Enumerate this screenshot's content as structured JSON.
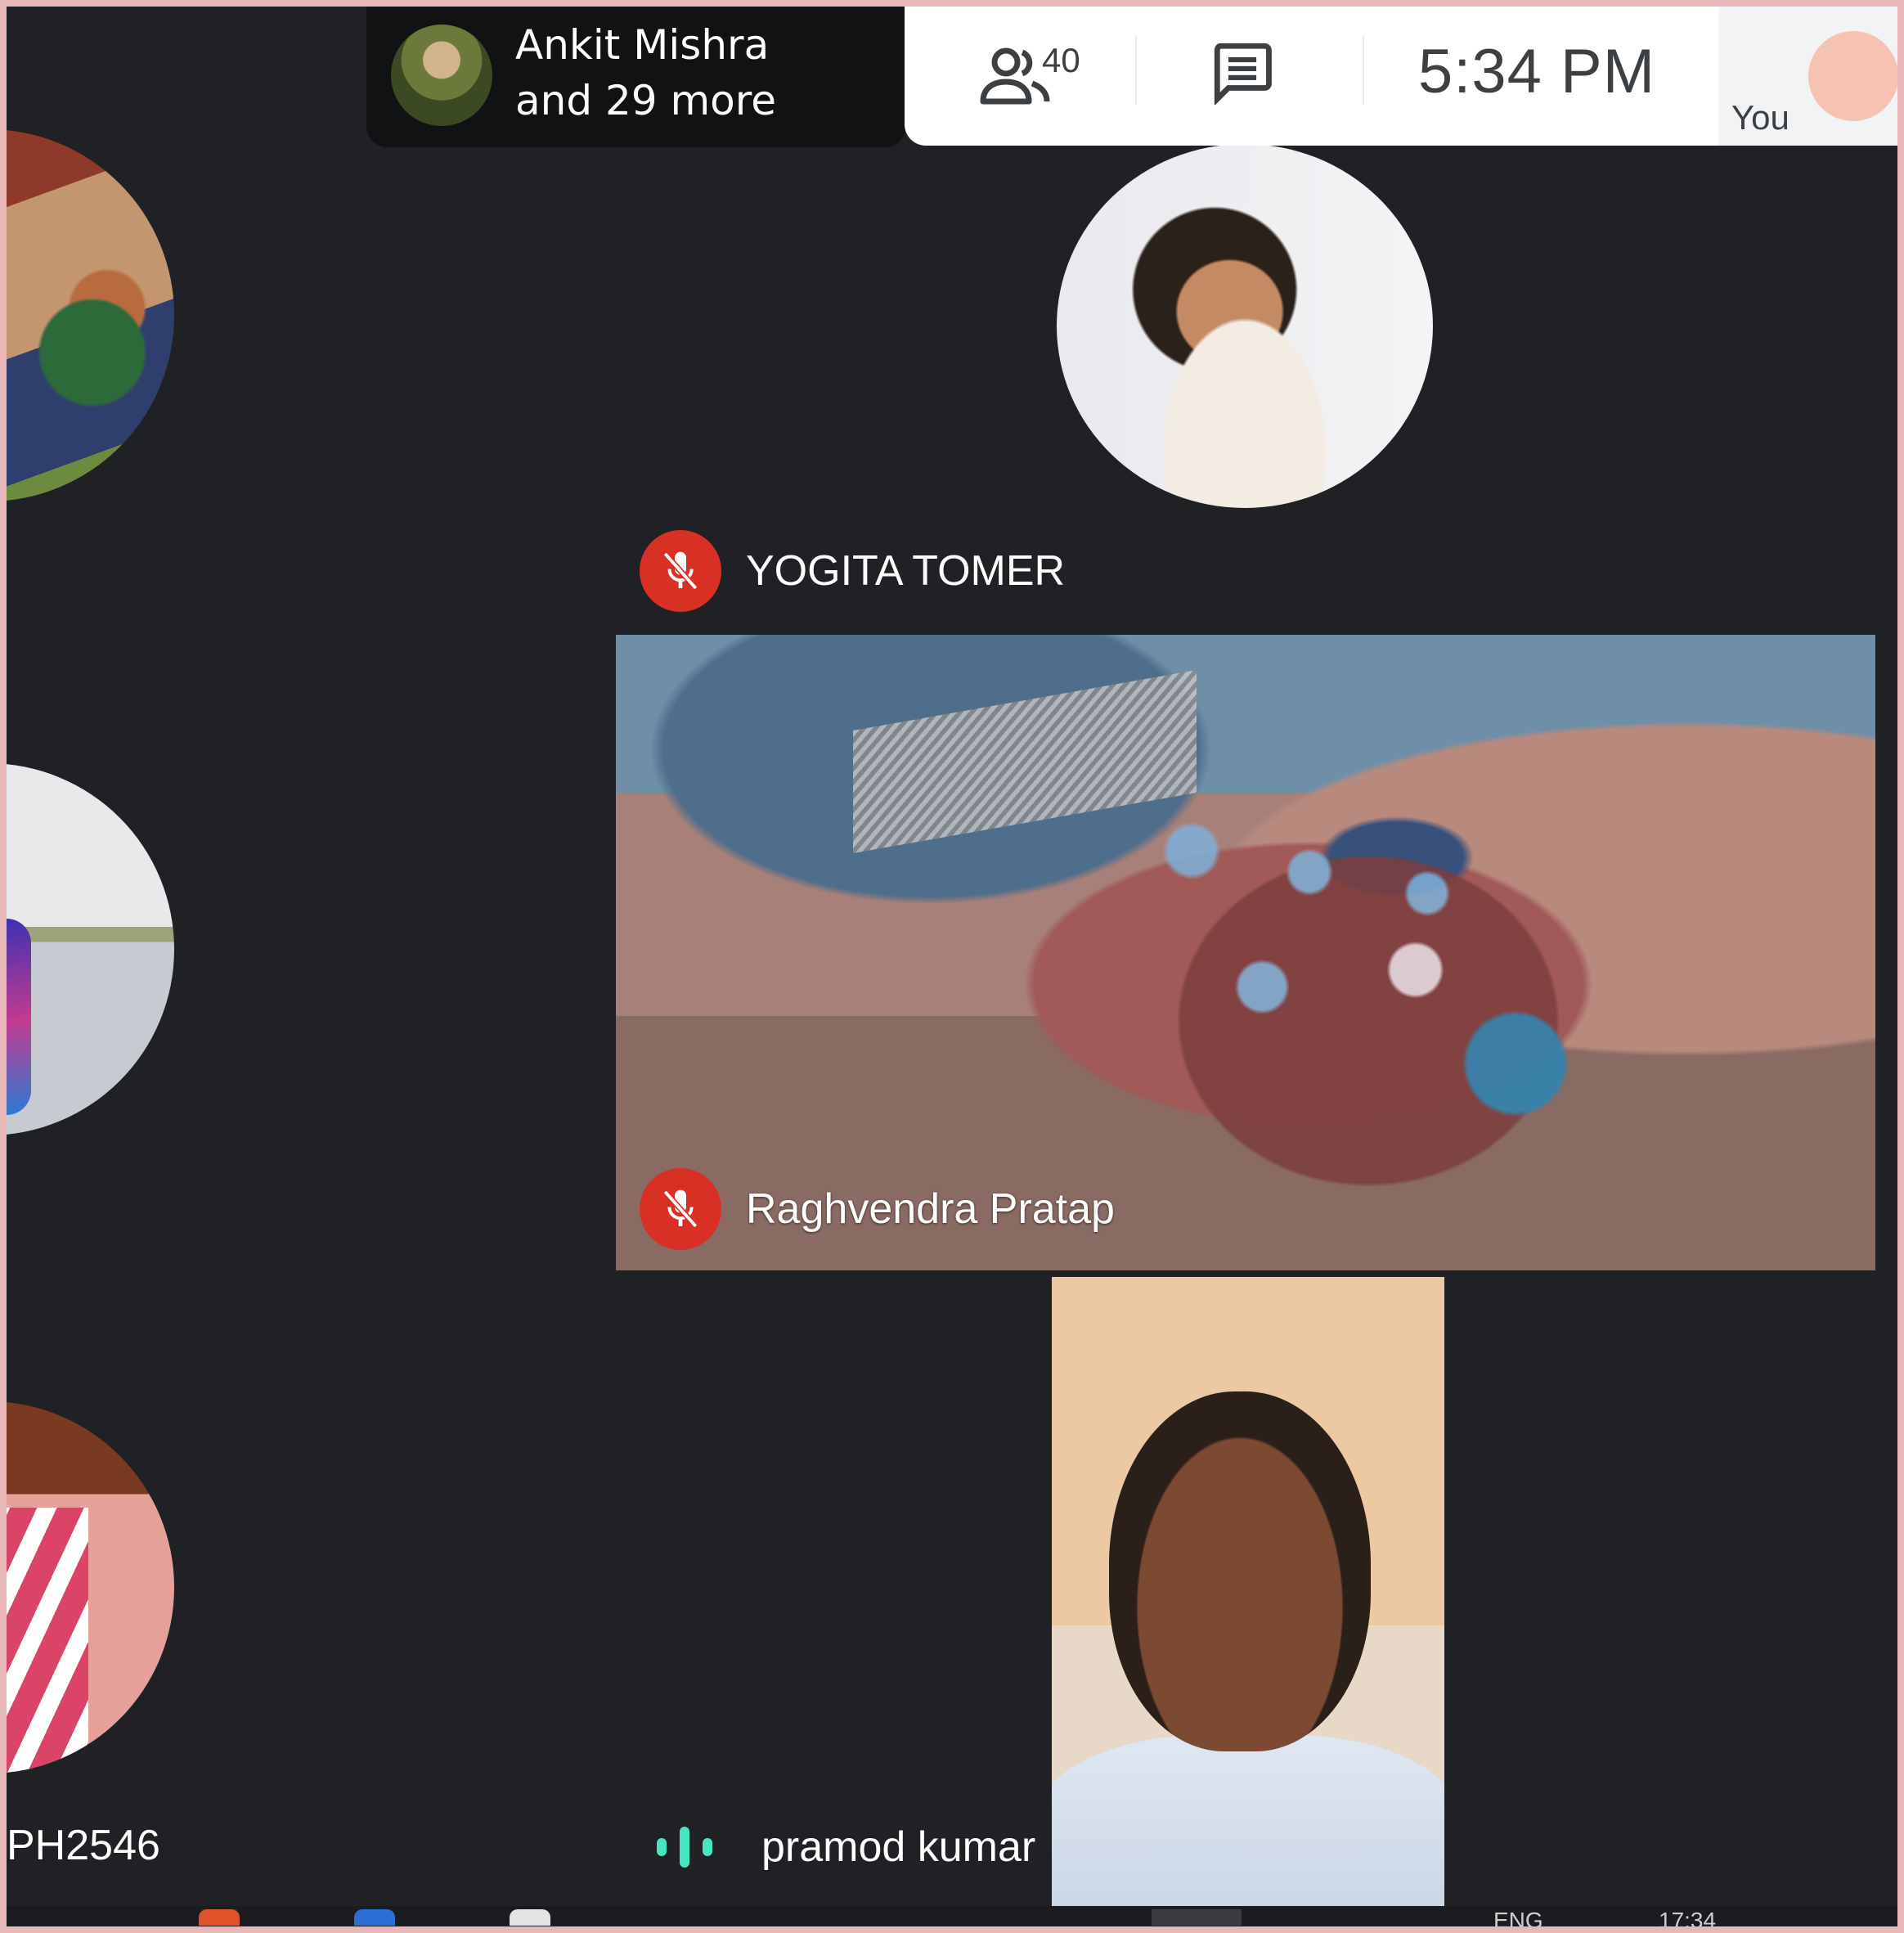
{
  "presenter": {
    "line1": "Ankit Mishra",
    "line2": "and 29 more"
  },
  "topbar": {
    "people_count": "40",
    "time": "5:34  PM",
    "self_label": "You"
  },
  "side": {
    "bottom_name": "PH2546"
  },
  "tiles": {
    "yogita": {
      "name": "YOGITA TOMER"
    },
    "raghvendra": {
      "name": "Raghvendra Pratap"
    },
    "pramod": {
      "name": "pramod kumar"
    }
  },
  "taskbar": {
    "lang": "ENG",
    "clock": "17:34"
  },
  "colors": {
    "mic_off": "#d93025",
    "speaking": "#46e6c2",
    "background": "#202124",
    "frame": "#e8b7b7"
  },
  "icons": [
    "people-icon",
    "chat-icon",
    "mic-off-icon",
    "speaking-indicator-icon"
  ]
}
